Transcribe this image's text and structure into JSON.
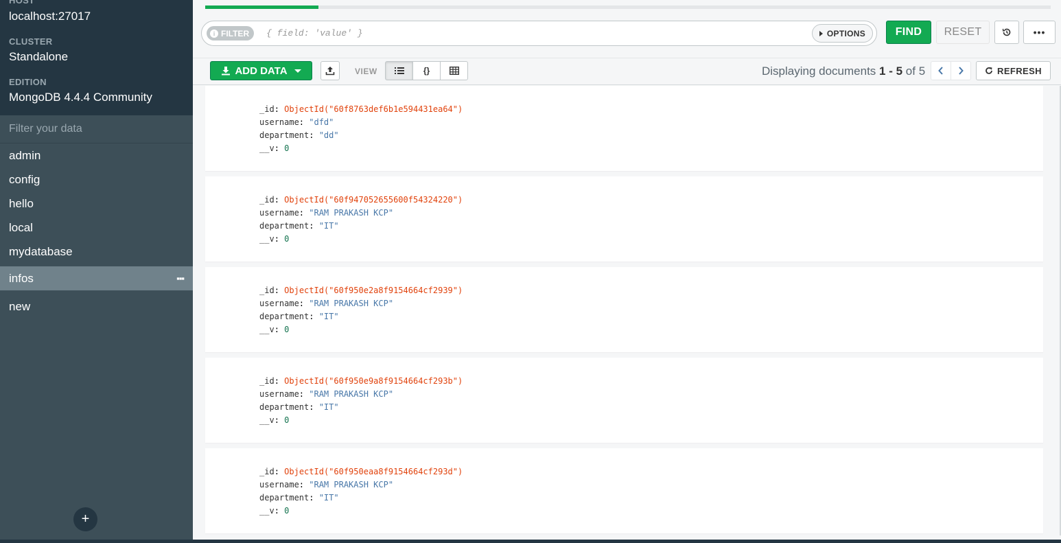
{
  "sidebar": {
    "host_label": "HOST",
    "host_value": "localhost:27017",
    "cluster_label": "CLUSTER",
    "cluster_value": "Standalone",
    "edition_label": "EDITION",
    "edition_value": "MongoDB 4.4.4 Community",
    "filter_placeholder": "Filter your data",
    "databases": [
      "admin",
      "config",
      "hello",
      "local",
      "mydatabase"
    ],
    "active_collection": "infos",
    "extra_db": "new",
    "add_label": "+"
  },
  "query": {
    "filter_pill": "FILTER",
    "filter_placeholder": "{ field: 'value' }",
    "options_label": "OPTIONS",
    "find_label": "FIND",
    "reset_label": "RESET",
    "more_label": "•••",
    "progress_fraction": 0.134
  },
  "toolbar": {
    "add_data_label": "ADD DATA",
    "view_label": "VIEW",
    "paging_prefix": "Displaying documents ",
    "paging_range": "1 - 5",
    "paging_of": " of ",
    "paging_total": "5",
    "refresh_label": "REFRESH"
  },
  "documents": [
    {
      "id_key": "_id",
      "id": "ObjectId(\"60f8763def6b1e594431ea64\")",
      "username_key": "username",
      "username": "\"dfd\"",
      "department_key": "department",
      "department": "\"dd\"",
      "v_key": "__v",
      "v": "0"
    },
    {
      "id_key": "_id",
      "id": "ObjectId(\"60f947052655600f54324220\")",
      "username_key": "username",
      "username": "\"RAM PRAKASH KCP\"",
      "department_key": "department",
      "department": "\"IT\"",
      "v_key": "__v",
      "v": "0"
    },
    {
      "id_key": "_id",
      "id": "ObjectId(\"60f950e2a8f9154664cf2939\")",
      "username_key": "username",
      "username": "\"RAM PRAKASH KCP\"",
      "department_key": "department",
      "department": "\"IT\"",
      "v_key": "__v",
      "v": "0"
    },
    {
      "id_key": "_id",
      "id": "ObjectId(\"60f950e9a8f9154664cf293b\")",
      "username_key": "username",
      "username": "\"RAM PRAKASH KCP\"",
      "department_key": "department",
      "department": "\"IT\"",
      "v_key": "__v",
      "v": "0"
    },
    {
      "id_key": "_id",
      "id": "ObjectId(\"60f950eaa8f9154664cf293d\")",
      "username_key": "username",
      "username": "\"RAM PRAKASH KCP\"",
      "department_key": "department",
      "department": "\"IT\"",
      "v_key": "__v",
      "v": "0"
    }
  ],
  "colors": {
    "accent_green": "#13aa52",
    "sidebar_bg": "#3d4f58",
    "sidebar_header_bg": "#243642",
    "objectid_color": "#e1420c",
    "string_color": "#4877a8",
    "number_color": "#13734f"
  },
  "icons": [
    "info-icon",
    "caret-right-icon",
    "history-icon",
    "download-icon",
    "caret-down-icon",
    "export-icon",
    "list-view-icon",
    "json-view-icon",
    "table-view-icon",
    "chevron-left-icon",
    "chevron-right-icon",
    "refresh-icon",
    "ellipsis-icon",
    "plus-icon"
  ]
}
